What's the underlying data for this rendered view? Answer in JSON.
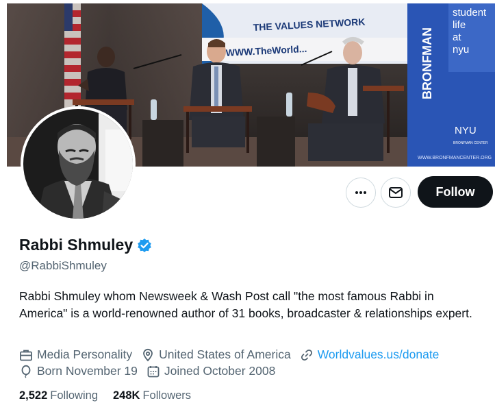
{
  "banner": {
    "sign_top": "THE VALUES NETWORK",
    "sign_url": "WWW.TheWorld...",
    "side_banner_text": "BRONFMAN",
    "side_banner_lines": [
      "student",
      "life",
      "at",
      "nyu"
    ],
    "nyu_text": "NYU",
    "side_banner_small": "BRONFMAN CENTER",
    "side_banner_url": "WWW.BRONFMANCENTER.ORG"
  },
  "actions": {
    "more_icon": "more-dots-icon",
    "message_icon": "envelope-icon",
    "follow_label": "Follow"
  },
  "profile": {
    "name": "Rabbi Shmuley",
    "verified_icon": "verified-badge-icon",
    "handle": "@RabbiShmuley",
    "bio": "Rabbi Shmuley whom Newsweek & Wash Post call \"the most famous Rabbi in America\" is a world-renowned author of 31 books, broadcaster & relationships expert."
  },
  "meta": {
    "category": "Media Personality",
    "location": "United States of America",
    "website": "Worldvalues.us/donate",
    "born": "Born November 19",
    "joined": "Joined October 2008"
  },
  "stats": {
    "following_count": "2,522",
    "following_label": "Following",
    "followers_count": "248K",
    "followers_label": "Followers"
  },
  "colors": {
    "accent": "#1d9bf0",
    "text_primary": "#0f1419",
    "text_secondary": "#536471",
    "follow_bg": "#0f1419"
  }
}
